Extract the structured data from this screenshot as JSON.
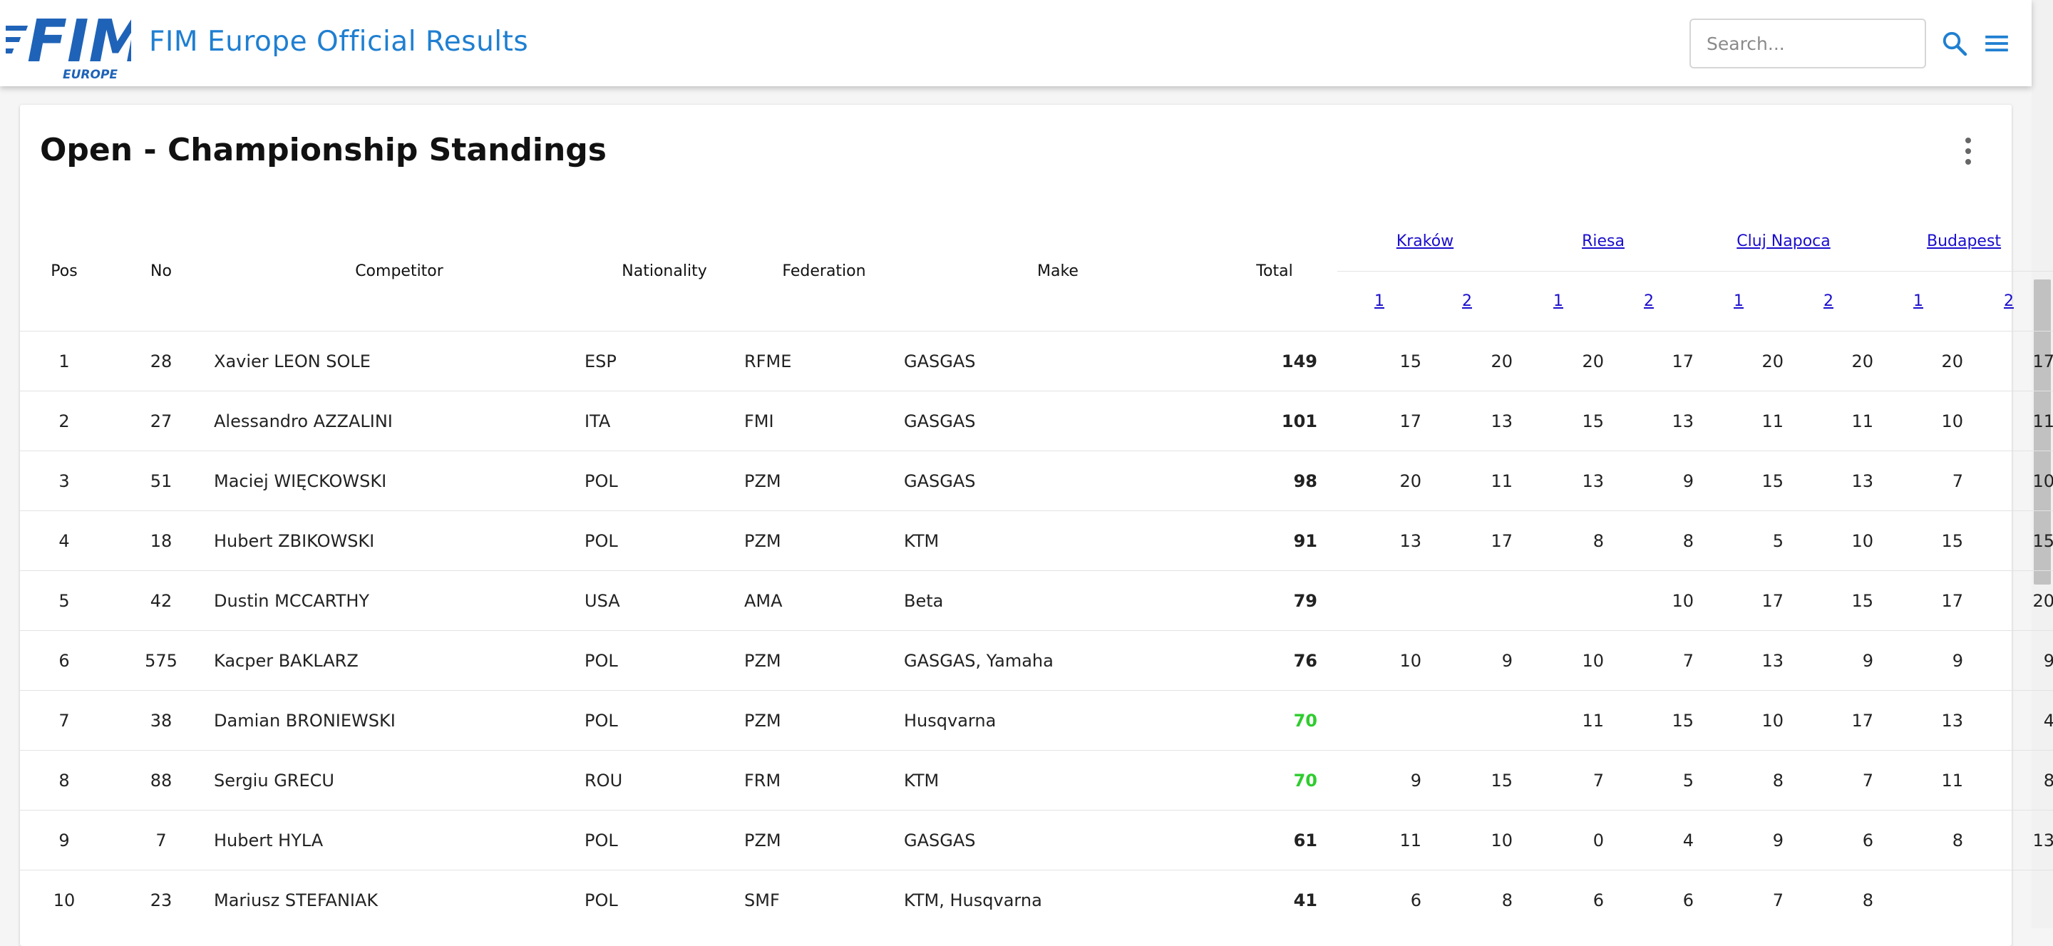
{
  "header": {
    "logo_text": "FIM",
    "logo_subtext": "EUROPE",
    "title": "FIM Europe Official Results",
    "search_placeholder": "Search..."
  },
  "colors": {
    "brand_blue": "#1f7fd1",
    "link_blue": "#1a0dcc",
    "total_highlight": "#2ecc2e"
  },
  "page_title": "Open - Championship Standings",
  "table": {
    "columns": {
      "pos": "Pos",
      "no": "No",
      "competitor": "Competitor",
      "nationality": "Nationality",
      "federation": "Federation",
      "make": "Make",
      "total": "Total"
    },
    "events": [
      {
        "name": "Kraków",
        "rounds": [
          "1",
          "2"
        ]
      },
      {
        "name": "Riesa",
        "rounds": [
          "1",
          "2"
        ]
      },
      {
        "name": "Cluj Napoca",
        "rounds": [
          "1",
          "2"
        ]
      },
      {
        "name": "Budapest",
        "rounds": [
          "1",
          "2"
        ]
      }
    ],
    "rows": [
      {
        "pos": "1",
        "no": "28",
        "competitor": "Xavier LEON SOLE",
        "nationality": "ESP",
        "federation": "RFME",
        "make": "GASGAS",
        "total": "149",
        "highlight": false,
        "points": [
          "15",
          "20",
          "20",
          "17",
          "20",
          "20",
          "20",
          "17"
        ]
      },
      {
        "pos": "2",
        "no": "27",
        "competitor": "Alessandro AZZALINI",
        "nationality": "ITA",
        "federation": "FMI",
        "make": "GASGAS",
        "total": "101",
        "highlight": false,
        "points": [
          "17",
          "13",
          "15",
          "13",
          "11",
          "11",
          "10",
          "11"
        ]
      },
      {
        "pos": "3",
        "no": "51",
        "competitor": "Maciej WIĘCKOWSKI",
        "nationality": "POL",
        "federation": "PZM",
        "make": "GASGAS",
        "total": "98",
        "highlight": false,
        "points": [
          "20",
          "11",
          "13",
          "9",
          "15",
          "13",
          "7",
          "10"
        ]
      },
      {
        "pos": "4",
        "no": "18",
        "competitor": "Hubert ZBIKOWSKI",
        "nationality": "POL",
        "federation": "PZM",
        "make": "KTM",
        "total": "91",
        "highlight": false,
        "points": [
          "13",
          "17",
          "8",
          "8",
          "5",
          "10",
          "15",
          "15"
        ]
      },
      {
        "pos": "5",
        "no": "42",
        "competitor": "Dustin MCCARTHY",
        "nationality": "USA",
        "federation": "AMA",
        "make": "Beta",
        "total": "79",
        "highlight": false,
        "points": [
          "",
          "",
          "",
          "10",
          "17",
          "15",
          "17",
          "20"
        ]
      },
      {
        "pos": "6",
        "no": "575",
        "competitor": "Kacper BAKLARZ",
        "nationality": "POL",
        "federation": "PZM",
        "make": "GASGAS, Yamaha",
        "total": "76",
        "highlight": false,
        "points": [
          "10",
          "9",
          "10",
          "7",
          "13",
          "9",
          "9",
          "9"
        ]
      },
      {
        "pos": "7",
        "no": "38",
        "competitor": "Damian BRONIEWSKI",
        "nationality": "POL",
        "federation": "PZM",
        "make": "Husqvarna",
        "total": "70",
        "highlight": true,
        "points": [
          "",
          "",
          "11",
          "15",
          "10",
          "17",
          "13",
          "4"
        ]
      },
      {
        "pos": "8",
        "no": "88",
        "competitor": "Sergiu GRECU",
        "nationality": "ROU",
        "federation": "FRM",
        "make": "KTM",
        "total": "70",
        "highlight": true,
        "points": [
          "9",
          "15",
          "7",
          "5",
          "8",
          "7",
          "11",
          "8"
        ]
      },
      {
        "pos": "9",
        "no": "7",
        "competitor": "Hubert HYLA",
        "nationality": "POL",
        "federation": "PZM",
        "make": "GASGAS",
        "total": "61",
        "highlight": false,
        "points": [
          "11",
          "10",
          "0",
          "4",
          "9",
          "6",
          "8",
          "13"
        ]
      },
      {
        "pos": "10",
        "no": "23",
        "competitor": "Mariusz STEFANIAK",
        "nationality": "POL",
        "federation": "SMF",
        "make": "KTM, Husqvarna",
        "total": "41",
        "highlight": false,
        "points": [
          "6",
          "8",
          "6",
          "6",
          "7",
          "8",
          "",
          ""
        ]
      }
    ]
  }
}
